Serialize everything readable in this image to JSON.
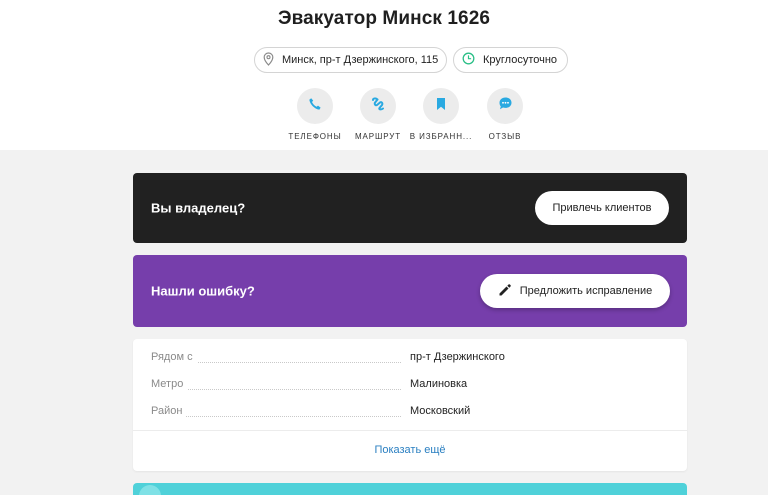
{
  "title": "Эвакуатор Минск 1626",
  "chips": {
    "address": {
      "label": "Минск, пр-т Дзержинского, 115",
      "icon": "map-pin-icon"
    },
    "hours": {
      "label": "Круглосуточно",
      "icon": "clock-icon"
    }
  },
  "actions": [
    {
      "label": "ТЕЛЕФОНЫ",
      "icon": "phone-icon"
    },
    {
      "label": "МАРШРУТ",
      "icon": "route-icon"
    },
    {
      "label": "В ИЗБРАНН...",
      "icon": "bookmark-icon"
    },
    {
      "label": "ОТЗЫВ",
      "icon": "chat-icon"
    }
  ],
  "owner_card": {
    "title": "Вы владелец?",
    "button": "Привлечь клиентов"
  },
  "error_card": {
    "title": "Нашли ошибку?",
    "button": "Предложить исправление",
    "button_icon": "pencil-icon"
  },
  "info": {
    "rows": [
      {
        "label": "Рядом с",
        "value": "пр-т Дзержинского"
      },
      {
        "label": "Метро",
        "value": "Малиновка"
      },
      {
        "label": "Район",
        "value": "Московский"
      }
    ],
    "show_more": "Показать ещё"
  },
  "colors": {
    "accent": "#29a9e1",
    "hours_icon": "#2bbf87",
    "dark_card": "#212121",
    "purple_card": "#763eab",
    "link": "#2a7fc1",
    "teal_strip": "#4fd1d9"
  }
}
